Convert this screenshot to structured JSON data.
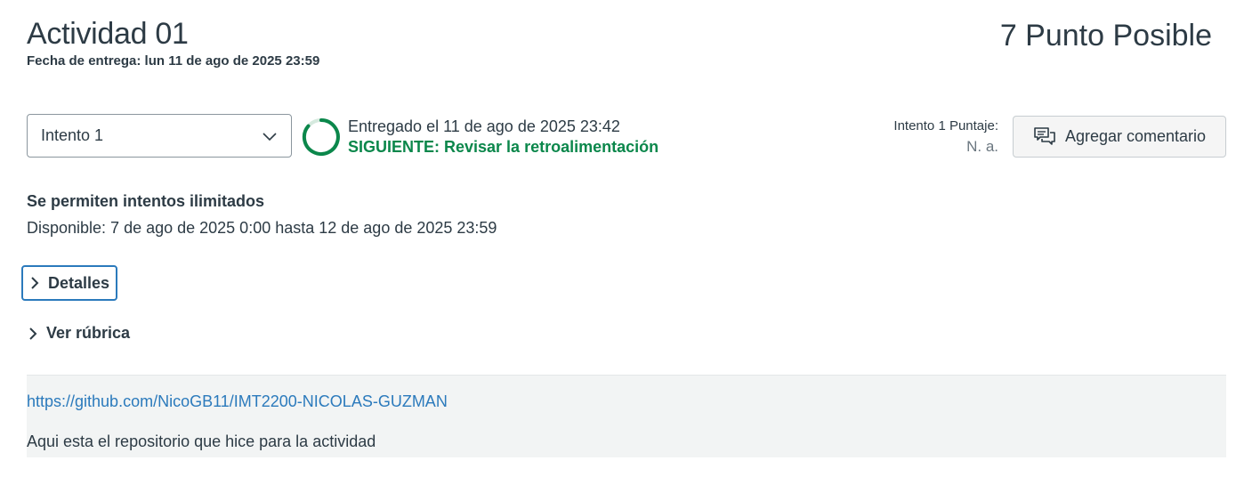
{
  "assignment": {
    "title": "Actividad 01",
    "due_date": "Fecha de entrega: lun 11 de ago de 2025 23:59",
    "points": "7 Punto Posible"
  },
  "attempt": {
    "selected": "Intento 1",
    "status": "Entregado el 11 de ago de 2025 23:42",
    "next_step": "SIGUIENTE: Revisar la retroalimentación",
    "score_label": "Intento 1 Puntaje:",
    "score_value": "N. a.",
    "comment_button": "Agregar comentario"
  },
  "info": {
    "attempts_allowed": "Se permiten intentos ilimitados",
    "availability": "Disponible: 7 de ago de 2025 0:00 hasta 12 de ago de 2025 23:59"
  },
  "toggles": {
    "details": "Detalles",
    "rubric": "Ver rúbrica"
  },
  "submission": {
    "link": "https://github.com/NicoGB11/IMT2200-NICOLAS-GUZMAN",
    "comment": "Aqui esta el repositorio que hice para la actividad"
  },
  "colors": {
    "text": "#2d3b45",
    "success": "#0b874b",
    "link": "#2b7abc",
    "submission_bg": "#f2f4f4"
  },
  "icons": {
    "select": "chevron-down-icon",
    "progress": "progress-ring-icon",
    "comment": "comment-icon",
    "toggle": "chevron-right-icon"
  }
}
